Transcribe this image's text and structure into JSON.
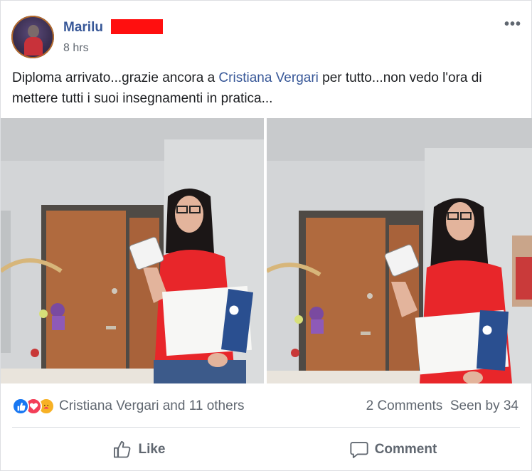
{
  "post": {
    "author": "Marilu",
    "time": "8 hrs",
    "more_icon": "more-horizontal-icon",
    "text_before": "Diploma arrivato...grazie ancora a ",
    "mention": "Cristiana Vergari",
    "text_after": " per tutto...non vedo l'ora di mettere tutti i suoi insegnamenti in pratica...",
    "photos": [
      {
        "icon": "photo-woman-with-diploma-1"
      },
      {
        "icon": "photo-woman-with-diploma-2"
      }
    ]
  },
  "engagement": {
    "reaction_icons": [
      "like-icon",
      "love-icon",
      "care-icon"
    ],
    "reaction_summary": "Cristiana Vergari and 11 others",
    "comments": "2 Comments",
    "seen": "Seen by 34"
  },
  "actions": {
    "like_label": "Like",
    "comment_label": "Comment"
  },
  "colors": {
    "link": "#385898",
    "secondary_text": "#606770",
    "redaction": "#ff0f0f",
    "like": "#1877f2",
    "love": "#f33e58",
    "care": "#f7b125",
    "shirt": "#e8262a"
  }
}
